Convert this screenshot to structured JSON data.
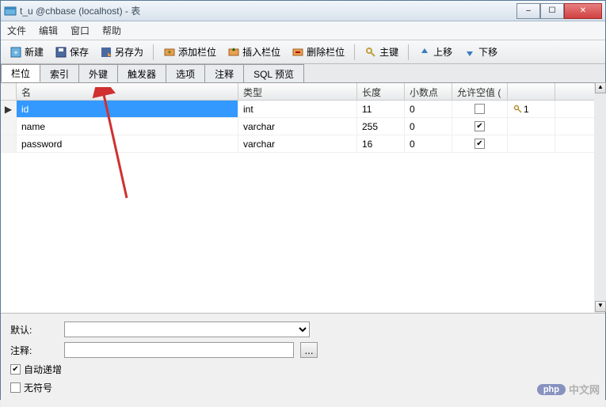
{
  "window": {
    "title": "t_u @chbase (localhost) - 表"
  },
  "menu": {
    "file": "文件",
    "edit": "编辑",
    "window": "窗口",
    "help": "帮助"
  },
  "toolbar": {
    "new": "新建",
    "save": "保存",
    "save_as": "另存为",
    "add_field": "添加栏位",
    "insert_field": "插入栏位",
    "delete_field": "删除栏位",
    "primary_key": "主键",
    "move_up": "上移",
    "move_down": "下移"
  },
  "tabs": {
    "fields": "栏位",
    "indexes": "索引",
    "foreign_keys": "外键",
    "triggers": "触发器",
    "options": "选项",
    "comment": "注释",
    "sql_preview": "SQL 预览"
  },
  "grid": {
    "headers": {
      "name": "名",
      "type": "类型",
      "length": "长度",
      "decimal": "小数点",
      "allow_null": "允许空值 ("
    },
    "rows": [
      {
        "name": "id",
        "type": "int",
        "length": "11",
        "decimal": "0",
        "allow_null": false,
        "key": "1"
      },
      {
        "name": "name",
        "type": "varchar",
        "length": "255",
        "decimal": "0",
        "allow_null": true,
        "key": ""
      },
      {
        "name": "password",
        "type": "varchar",
        "length": "16",
        "decimal": "0",
        "allow_null": true,
        "key": ""
      }
    ]
  },
  "bottom": {
    "default_label": "默认:",
    "default_value": "",
    "comment_label": "注释:",
    "comment_value": "",
    "more_btn": "...",
    "auto_increment": "自动递增",
    "unsigned": "无符号"
  },
  "watermark": {
    "badge": "php",
    "text": "中文网"
  }
}
